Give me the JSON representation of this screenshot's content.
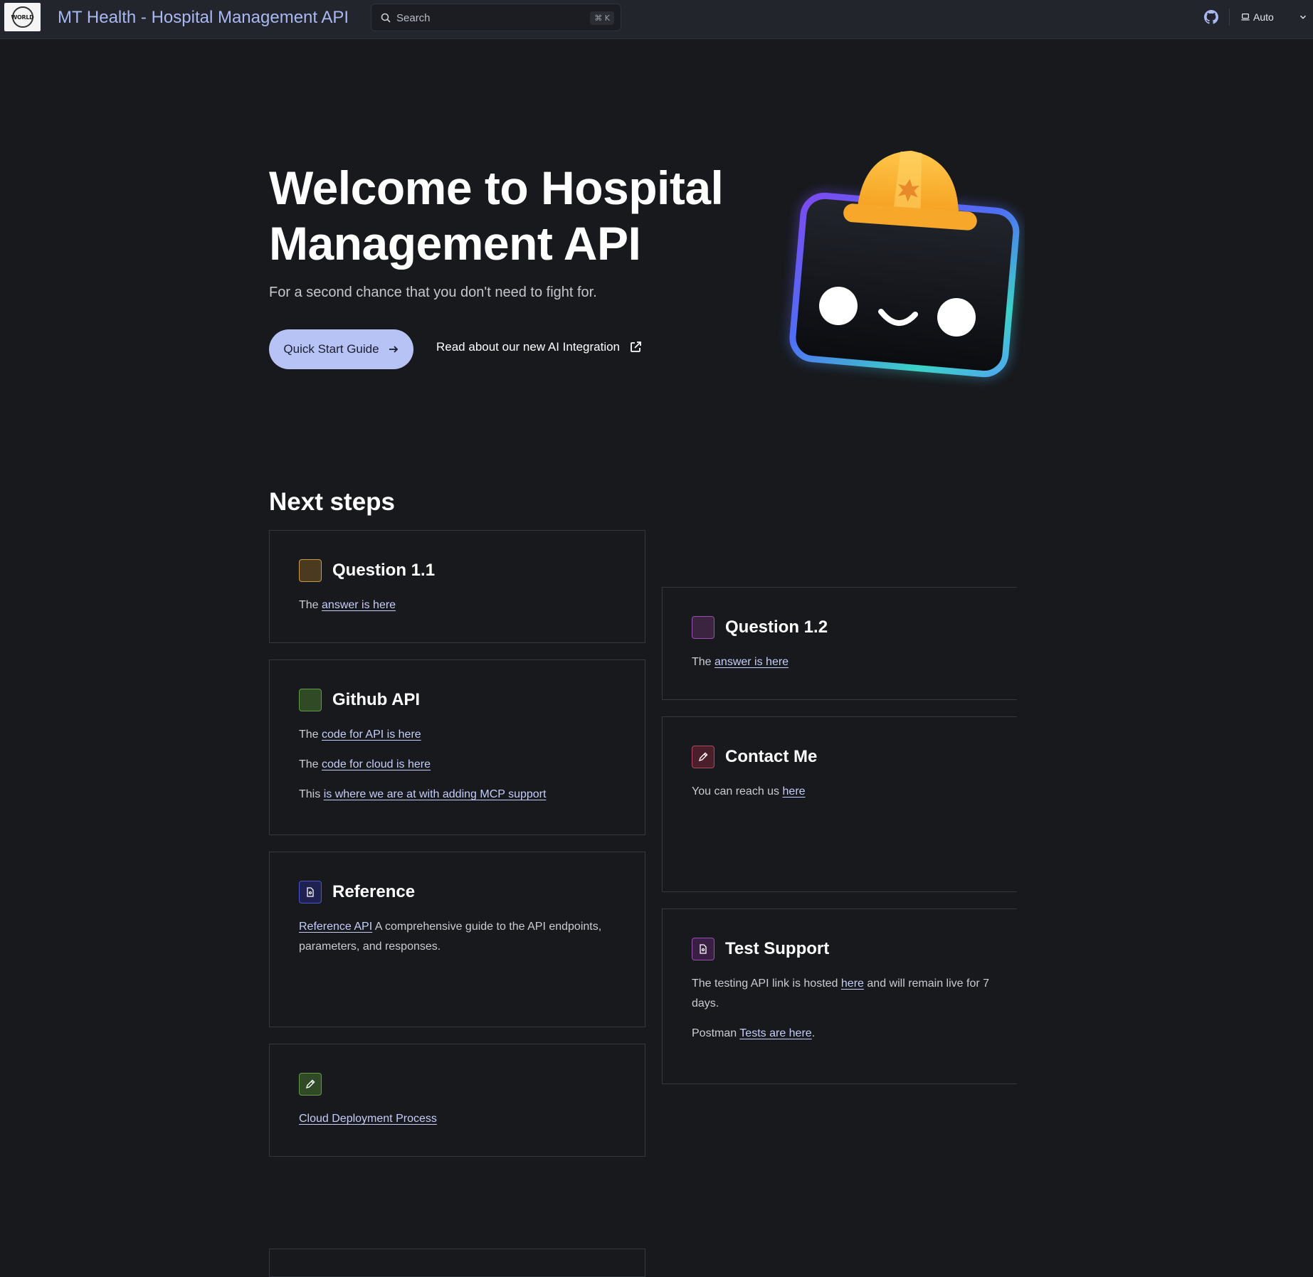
{
  "header": {
    "logo_text": "WORLD",
    "site_title": "MT Health - Hospital Management API",
    "search_placeholder": "Search",
    "search_shortcut": "⌘ K",
    "theme_label": "Auto"
  },
  "hero": {
    "title": "Welcome to Hospital Management API",
    "subtitle": "For a second chance that you don't need to fight for.",
    "primary_button": "Quick Start Guide",
    "secondary_link": "Read about our new AI Integration"
  },
  "next_steps": {
    "title": "Next steps",
    "q11": {
      "title": "Question 1.1",
      "prefix": "The",
      "link": "answer is here"
    },
    "q12": {
      "title": "Question 1.2",
      "prefix": "The",
      "link": "answer is here"
    },
    "github": {
      "title": "Github API",
      "line1_prefix": "The",
      "line1_link": "code for API is here",
      "line2_prefix": "The",
      "line2_link": "code for cloud is here",
      "line3_prefix": "This",
      "line3_link": "is where we are at with adding MCP support"
    },
    "contact": {
      "title": "Contact Me",
      "prefix": "You can reach us",
      "link": "here"
    },
    "reference": {
      "title": "Reference",
      "link": "Reference API",
      "text": "A comprehensive guide to the API endpoints, parameters, and responses."
    },
    "test_support": {
      "title": "Test Support",
      "line1_prefix": "The testing API link is hosted",
      "line1_link": "here",
      "line1_suffix": "and will remain live for 7 days.",
      "line2_prefix": "Postman",
      "line2_link": "Tests are here",
      "line2_suffix": "."
    },
    "cloud": {
      "link": "Cloud Deployment Process"
    }
  },
  "colors": {
    "background": "#17191d",
    "accent": "#b7c3f5",
    "title_blue": "#a9b8f2"
  }
}
